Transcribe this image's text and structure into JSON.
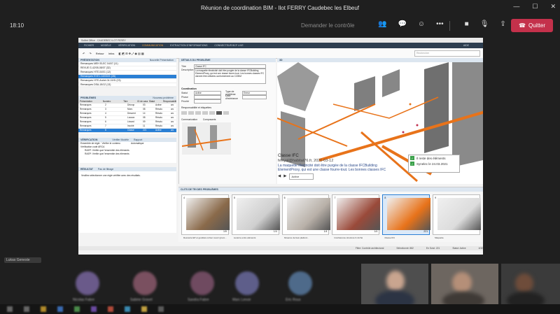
{
  "window": {
    "title": "Réunion de coordination BIM - Ilot FERRY Caudebec les Elbeuf",
    "minimize": "—",
    "maximize": "☐",
    "close": "✕"
  },
  "meeting": {
    "timer": "18:10",
    "request_control": "Demander le contrôle",
    "quit_label": "Quitter",
    "icons": [
      "people-icon",
      "chat-icon",
      "reactions-icon",
      "more-icon",
      "camera-icon",
      "mic-icon",
      "share-icon"
    ]
  },
  "app": {
    "title": "Solibri Office - CAUDEBEC ILOT FERRY",
    "ribbon": [
      "FICHIER",
      "MODÈLE",
      "VÉRIFICATION",
      "COMMUNICATION",
      "EXTRACTION D'INFORMATIONS",
      "CONNECTEUR BCF LIVE"
    ],
    "ribbon_active_index": 3,
    "ribbon_mini": "AIDE",
    "toolbar": {
      "retour": "Retour",
      "infos": "Infos",
      "search_placeholder": "Rechercher"
    },
    "presentation": {
      "header": "PRÉSENTATION",
      "new_button": "Nouvelle Présentation",
      "report_button": "Rapport",
      "items": [
        "Remarques MEH ELEC 04/07 (11)",
        "REVUE G-42/05-08/07 (32)",
        "Remarques HTE-04/01 (12)",
        "Remarques EXE1-14/03/21 (28)",
        "Remarques HTE-Arché-04-19/3/ (23)",
        "Remarques DSA-18/12 (13)"
      ],
      "selected_index": 3
    },
    "problems": {
      "header": "PROBLÈMES",
      "new_button": "Nouveau problème",
      "columns": [
        "Présentation",
        "Numéro",
        "Titre",
        "ID de cassé",
        "Statut",
        "Responsabilité"
      ],
      "rows": [
        [
          "Remarques",
          "2",
          "Décrop",
          "03",
          "Active",
          "arc"
        ],
        [
          "Remarques",
          "3",
          "Murs",
          "08",
          "Résolu",
          "arc"
        ],
        [
          "Remarques",
          "4",
          "Descent",
          "14",
          "Résolu",
          "arc"
        ],
        [
          "Remarques",
          "5",
          "Locaux",
          "08",
          "Résolu",
          "arc"
        ],
        [
          "Remarques",
          "6",
          "Lézard",
          "09",
          "Résolu",
          "arc"
        ],
        [
          "Remarques",
          "7",
          "Incohé",
          "11",
          "Résolu",
          "arc"
        ],
        [
          "Remarques",
          "8",
          "Classe",
          "221",
          "Active",
          "arc"
        ]
      ],
      "selected_index": 6
    },
    "verification": {
      "header": "VÉRIFICATION",
      "verify_button": "Vérifier Modèle",
      "report_button": "Rapport",
      "subheader": "Ensemble de règle",
      "subheader_value": "Vérifier le contenu",
      "auto_label": "Automatique",
      "rows": [
        "Vérification code ARCA",
        "RAEP: Vérifie que l'ensemble des éléments",
        "RAEP: Vérifie que l'ensemble des éléments"
      ]
    },
    "result": {
      "header": "RÉSULTAT",
      "filter": "Pas de filtrage",
      "text": "Veuillez sélectionner une règle vérifiée avec des résultats."
    },
    "details": {
      "header": "DÉTAILS DU PROBLÈME",
      "title_label": "Titre",
      "title_value": "Classe IFC",
      "description_label": "Description",
      "description_value": "La maquette électricité doit être purgée de la classe IFCBuilding ElementProxy, qui est une classe fourre-tout. Les bonnes classes IFC doivent être utilisées conformément au CCBIM",
      "coordination_label": "Coordination",
      "status_label": "Statut",
      "status_value": "Active",
      "type_label": "Type de problème",
      "type_value": "Erreur",
      "phase_label": "Phase",
      "phase_value": "",
      "due_label": "Date d'échéance",
      "due_value": "",
      "priority_label": "Priorité",
      "priority_value": "",
      "responsible_label": "Responsabilité et étiquettes",
      "tabs": [
        "Communication",
        "Composants"
      ]
    },
    "view3d": {
      "header": "3D",
      "issue_title": "Classe IFC",
      "issue_meta": "ferryal@habitat76.fr, 2021-03-12",
      "issue_text": "La maquette électricité doit être purgée de la classe IFCBuilding ElementProxy, qui est une classe fourre-tout. Les bonnes classes IFC",
      "status_value": "Active",
      "popup_lines": [
        "Il reste des éléments",
        "Synelec le 24.03.2021"
      ]
    },
    "slides": {
      "header": "CLITS DE TRI DES PROBLÈMES",
      "items": [
        {
          "num": "4",
          "count": "1/9",
          "caption": "Descente EP et gouttière à bien revoir (prem..."
        },
        {
          "num": "5",
          "count": "1/4",
          "caption": "Lucarne entre éléments"
        },
        {
          "num": "6",
          "count": "1/4",
          "caption": "Absence de faux plafond..."
        },
        {
          "num": "7",
          "count": "1/4",
          "caption": "Incohérence structure fx Arché"
        },
        {
          "num": "8",
          "count": "221",
          "caption": "Classe IFC"
        },
        {
          "num": "9",
          "count": "",
          "caption": "Maquette"
        }
      ],
      "selected_index": 4
    },
    "statusbar": [
      "Filtre: Contrôle architectural",
      "Sélectionné: 882",
      "En Suivi: 221",
      "Statut: Active",
      "4/32"
    ]
  },
  "participants": {
    "presenter_tag": "Lukas Geneste",
    "avatars": [
      {
        "name": "Nicolas Fabre",
        "color": "#6a5a8a"
      },
      {
        "name": "Sabine Gravel",
        "color": "#7a5060"
      },
      {
        "name": "Sandra Fabre",
        "color": "#6f4a60"
      },
      {
        "name": "Marc Lenoir",
        "color": "#5e5e8a"
      },
      {
        "name": "Eric Roux",
        "color": "#4e6a8a"
      }
    ]
  }
}
